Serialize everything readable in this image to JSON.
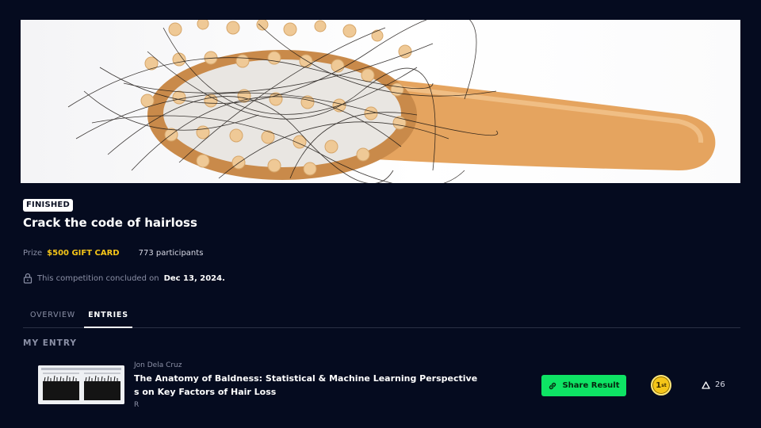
{
  "competition": {
    "status_badge": "FINISHED",
    "title": "Crack the code of hairloss",
    "prize_label": "Prize",
    "prize_value": "$500 GIFT CARD",
    "participants": "773 participants",
    "closed_text": "This competition concluded on",
    "closed_date": "Dec 13, 2024."
  },
  "tabs": [
    {
      "label": "OVERVIEW",
      "active": false
    },
    {
      "label": "ENTRIES",
      "active": true
    }
  ],
  "my_entry": {
    "section_title": "MY ENTRY",
    "author": "Jon Dela Cruz",
    "title": "The Anatomy of Baldness: Statistical & Machine Learning Perspectives on Key Factors of Hair Loss",
    "subtitle": "R",
    "share_label": "Share Result",
    "rank_main": "1",
    "rank_suffix": "st",
    "votes": "26"
  },
  "colors": {
    "background": "#050b1f",
    "prize": "#f5c518",
    "share_button": "#0ee364",
    "medal": "#f5c518"
  },
  "icons": [
    "lock-icon",
    "link-icon",
    "medal-icon",
    "upvote-triangle-icon"
  ]
}
